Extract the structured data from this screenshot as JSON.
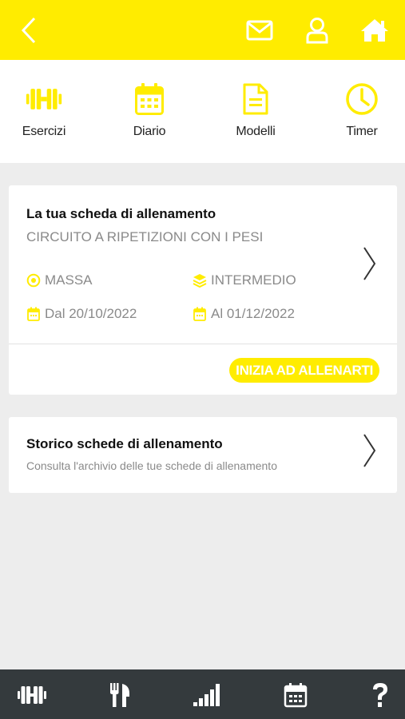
{
  "colors": {
    "accent": "#ffec00",
    "bottom_bar": "#343a3d",
    "background": "#ededed"
  },
  "topbar": {
    "icons": [
      "back-icon",
      "mail-icon",
      "user-icon",
      "home-icon"
    ]
  },
  "quicknav": {
    "items": [
      {
        "label": "Esercizi",
        "icon": "dumbbell-icon"
      },
      {
        "label": "Diario",
        "icon": "calendar-icon"
      },
      {
        "label": "Modelli",
        "icon": "document-icon"
      },
      {
        "label": "Timer",
        "icon": "clock-icon"
      }
    ]
  },
  "current_plan": {
    "title": "La tua scheda di allenamento",
    "name": "CIRCUITO A RIPETIZIONI CON I PESI",
    "goal": "MASSA",
    "level": "INTERMEDIO",
    "start": "Dal 20/10/2022",
    "end": "Al 01/12/2022",
    "cta": "INIZIA AD ALLENARTI"
  },
  "history": {
    "title": "Storico schede di allenamento",
    "subtitle": "Consulta l'archivio delle tue schede di allenamento"
  },
  "bottombar": {
    "icons": [
      "dumbbell-icon",
      "fork-knife-icon",
      "signal-bars-icon",
      "calendar-icon",
      "help-icon"
    ]
  }
}
